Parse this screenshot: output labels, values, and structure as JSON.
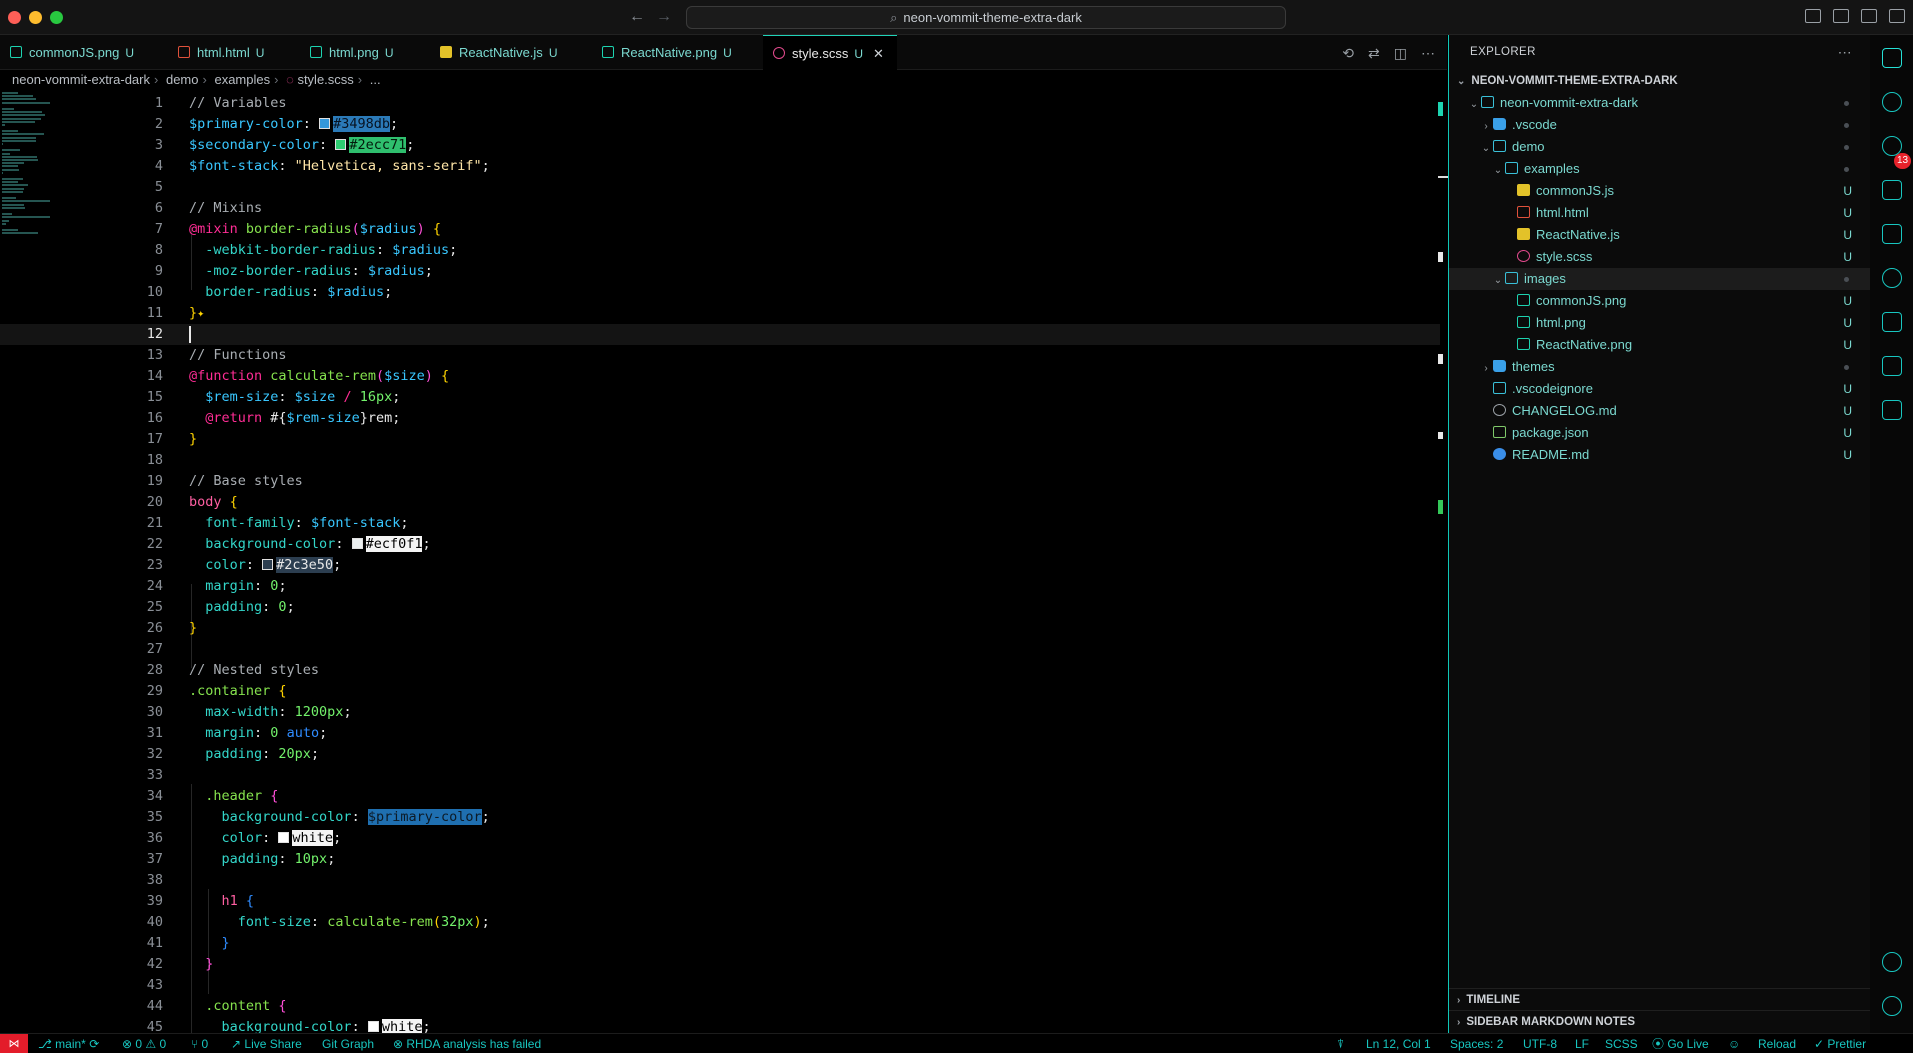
{
  "window": {
    "title": "neon-vommit-theme-extra-dark"
  },
  "tabs": [
    {
      "label": "commonJS.png",
      "status": "U",
      "type": "png"
    },
    {
      "label": "html.html",
      "status": "U",
      "type": "html"
    },
    {
      "label": "html.png",
      "status": "U",
      "type": "png"
    },
    {
      "label": "ReactNative.js",
      "status": "U",
      "type": "js"
    },
    {
      "label": "ReactNative.png",
      "status": "U",
      "type": "png"
    },
    {
      "label": "style.scss",
      "status": "U",
      "type": "scss",
      "active": true
    }
  ],
  "breadcrumb": [
    "neon-vommit-extra-dark",
    "demo",
    "examples",
    "style.scss",
    "..."
  ],
  "editor": {
    "current_line": 12,
    "lines": [
      [
        [
          "// Variables",
          "com"
        ]
      ],
      [
        [
          "$primary-color",
          "var"
        ],
        [
          ": ",
          "pun"
        ],
        [
          "#3498db",
          "hl-blue",
          "#3498db"
        ],
        [
          ";",
          "pun"
        ]
      ],
      [
        [
          "$secondary-color",
          "var"
        ],
        [
          ": ",
          "pun"
        ],
        [
          "#2ecc71",
          "hl-green",
          "#2ecc71"
        ],
        [
          ";",
          "pun"
        ]
      ],
      [
        [
          "$font-stack",
          "var"
        ],
        [
          ": ",
          "pun"
        ],
        [
          "\"Helvetica, sans-serif\"",
          "str"
        ],
        [
          ";",
          "pun"
        ]
      ],
      [],
      [
        [
          "// Mixins",
          "com"
        ]
      ],
      [
        [
          "@mixin ",
          "at"
        ],
        [
          "border-radius",
          "fn"
        ],
        [
          "(",
          "brace2"
        ],
        [
          "$radius",
          "var"
        ],
        [
          ") ",
          "brace2"
        ],
        [
          "{",
          "brace"
        ]
      ],
      [
        [
          "  -webkit-border-radius",
          "prop"
        ],
        [
          ": ",
          "pun"
        ],
        [
          "$radius",
          "var"
        ],
        [
          ";",
          "pun"
        ]
      ],
      [
        [
          "  -moz-border-radius",
          "prop"
        ],
        [
          ": ",
          "pun"
        ],
        [
          "$radius",
          "var"
        ],
        [
          ";",
          "pun"
        ]
      ],
      [
        [
          "  border-radius",
          "prop"
        ],
        [
          ": ",
          "pun"
        ],
        [
          "$radius",
          "var"
        ],
        [
          ";",
          "pun"
        ]
      ],
      [
        [
          "}",
          "brace"
        ],
        [
          "✦",
          "sparkle"
        ]
      ],
      [],
      [
        [
          "// Functions",
          "com"
        ]
      ],
      [
        [
          "@function ",
          "at"
        ],
        [
          "calculate-rem",
          "fn"
        ],
        [
          "(",
          "brace2"
        ],
        [
          "$size",
          "var"
        ],
        [
          ") ",
          "brace2"
        ],
        [
          "{",
          "brace"
        ]
      ],
      [
        [
          "  $rem-size",
          "var"
        ],
        [
          ": ",
          "pun"
        ],
        [
          "$size ",
          "var"
        ],
        [
          "/ ",
          "at"
        ],
        [
          "16px",
          "num"
        ],
        [
          ";",
          "pun"
        ]
      ],
      [
        [
          "  @return ",
          "at"
        ],
        [
          "#{",
          "txt"
        ],
        [
          "$rem-size",
          "var"
        ],
        [
          "}",
          "txt"
        ],
        [
          "rem",
          "txt"
        ],
        [
          ";",
          "pun"
        ]
      ],
      [
        [
          "}",
          "brace"
        ]
      ],
      [],
      [
        [
          "// Base styles",
          "com"
        ]
      ],
      [
        [
          "body ",
          "sel"
        ],
        [
          "{",
          "brace"
        ]
      ],
      [
        [
          "  font-family",
          "prop"
        ],
        [
          ": ",
          "pun"
        ],
        [
          "$font-stack",
          "var"
        ],
        [
          ";",
          "pun"
        ]
      ],
      [
        [
          "  background-color",
          "prop"
        ],
        [
          ": ",
          "pun"
        ],
        [
          "#ecf0f1",
          "hl-white",
          "#ecf0f1"
        ],
        [
          ";",
          "pun"
        ]
      ],
      [
        [
          "  color",
          "prop"
        ],
        [
          ": ",
          "pun"
        ],
        [
          "#2c3e50",
          "hl-dark",
          "#2c3e50"
        ],
        [
          ";",
          "pun"
        ]
      ],
      [
        [
          "  margin",
          "prop"
        ],
        [
          ": ",
          "pun"
        ],
        [
          "0",
          "num"
        ],
        [
          ";",
          "pun"
        ]
      ],
      [
        [
          "  padding",
          "prop"
        ],
        [
          ": ",
          "pun"
        ],
        [
          "0",
          "num"
        ],
        [
          ";",
          "pun"
        ]
      ],
      [
        [
          "}",
          "brace"
        ]
      ],
      [],
      [
        [
          "// Nested styles",
          "com"
        ]
      ],
      [
        [
          ".container ",
          "fn"
        ],
        [
          "{",
          "brace"
        ]
      ],
      [
        [
          "  max-width",
          "prop"
        ],
        [
          ": ",
          "pun"
        ],
        [
          "1200px",
          "num"
        ],
        [
          ";",
          "pun"
        ]
      ],
      [
        [
          "  margin",
          "prop"
        ],
        [
          ": ",
          "pun"
        ],
        [
          "0 ",
          "num"
        ],
        [
          "auto",
          "kw"
        ],
        [
          ";",
          "pun"
        ]
      ],
      [
        [
          "  padding",
          "prop"
        ],
        [
          ": ",
          "pun"
        ],
        [
          "20px",
          "num"
        ],
        [
          ";",
          "pun"
        ]
      ],
      [],
      [
        [
          "  .header ",
          "fn"
        ],
        [
          "{",
          "brace2"
        ]
      ],
      [
        [
          "    background-color",
          "prop"
        ],
        [
          ": ",
          "pun"
        ],
        [
          "$primary-color",
          "hl-sel"
        ],
        [
          ";",
          "pun"
        ]
      ],
      [
        [
          "    color",
          "prop"
        ],
        [
          ": ",
          "pun"
        ],
        [
          "white",
          "hl-white",
          "#ffffff"
        ],
        [
          ";",
          "pun"
        ]
      ],
      [
        [
          "    padding",
          "prop"
        ],
        [
          ": ",
          "pun"
        ],
        [
          "10px",
          "num"
        ],
        [
          ";",
          "pun"
        ]
      ],
      [],
      [
        [
          "    h1 ",
          "sel"
        ],
        [
          "{",
          "brace3"
        ]
      ],
      [
        [
          "      font-size",
          "prop"
        ],
        [
          ": ",
          "pun"
        ],
        [
          "calculate-rem",
          "fn"
        ],
        [
          "(",
          "brace"
        ],
        [
          "32px",
          "num"
        ],
        [
          ")",
          "brace"
        ],
        [
          ";",
          "pun"
        ]
      ],
      [
        [
          "    }",
          "brace3"
        ]
      ],
      [
        [
          "  }",
          "brace2"
        ]
      ],
      [],
      [
        [
          "  .content ",
          "fn"
        ],
        [
          "{",
          "brace2"
        ]
      ],
      [
        [
          "    background-color",
          "prop"
        ],
        [
          ": ",
          "pun"
        ],
        [
          "white",
          "hl-white",
          "#ffffff"
        ],
        [
          ";",
          "pun"
        ]
      ]
    ]
  },
  "explorer": {
    "title": "EXPLORER",
    "root": "NEON-VOMMIT-THEME-EXTRA-DARK",
    "items": [
      {
        "label": "neon-vommit-extra-dark",
        "depth": 0,
        "chev": "v",
        "icon": "folder-open",
        "mark": "dot"
      },
      {
        "label": ".vscode",
        "depth": 1,
        "chev": ">",
        "icon": "folder",
        "mark": "dot"
      },
      {
        "label": "demo",
        "depth": 1,
        "chev": "v",
        "icon": "folder-open",
        "mark": "dot"
      },
      {
        "label": "examples",
        "depth": 2,
        "chev": "v",
        "icon": "folder-open",
        "mark": "dot"
      },
      {
        "label": "commonJS.js",
        "depth": 3,
        "icon": "js",
        "mark": "U"
      },
      {
        "label": "html.html",
        "depth": 3,
        "icon": "html",
        "mark": "U"
      },
      {
        "label": "ReactNative.js",
        "depth": 3,
        "icon": "js",
        "mark": "U"
      },
      {
        "label": "style.scss",
        "depth": 3,
        "icon": "scss",
        "mark": "U"
      },
      {
        "label": "images",
        "depth": 2,
        "chev": "v",
        "icon": "folder-open",
        "mark": "dot",
        "selected": true
      },
      {
        "label": "commonJS.png",
        "depth": 3,
        "icon": "png",
        "mark": "U"
      },
      {
        "label": "html.png",
        "depth": 3,
        "icon": "png",
        "mark": "U"
      },
      {
        "label": "ReactNative.png",
        "depth": 3,
        "icon": "png",
        "mark": "U"
      },
      {
        "label": "themes",
        "depth": 1,
        "chev": ">",
        "icon": "folder",
        "mark": "dot"
      },
      {
        "label": ".vscodeignore",
        "depth": 1,
        "icon": "vsc",
        "mark": "U"
      },
      {
        "label": "CHANGELOG.md",
        "depth": 1,
        "icon": "clog",
        "mark": "U"
      },
      {
        "label": "package.json",
        "depth": 1,
        "icon": "pkg",
        "mark": "U"
      },
      {
        "label": "README.md",
        "depth": 1,
        "icon": "info",
        "mark": "U"
      }
    ],
    "sections": [
      "TIMELINE",
      "SIDEBAR MARKDOWN NOTES"
    ]
  },
  "activity_badge": "13",
  "statusbar": {
    "branch": "main*",
    "errors": "0",
    "warnings": "0",
    "ports": "0",
    "live_share": "Live Share",
    "git_graph": "Git Graph",
    "rhda": "RHDA analysis has failed",
    "position": "Ln 12, Col 1",
    "spaces": "Spaces: 2",
    "encoding": "UTF-8",
    "eol": "LF",
    "language": "SCSS",
    "go_live": "Go Live",
    "reload": "Reload",
    "prettier": "Prettier"
  },
  "colors": {
    "accent": "#18c6c0",
    "active_tab_border": "#20d3b8",
    "remote": "#e31c2a"
  }
}
